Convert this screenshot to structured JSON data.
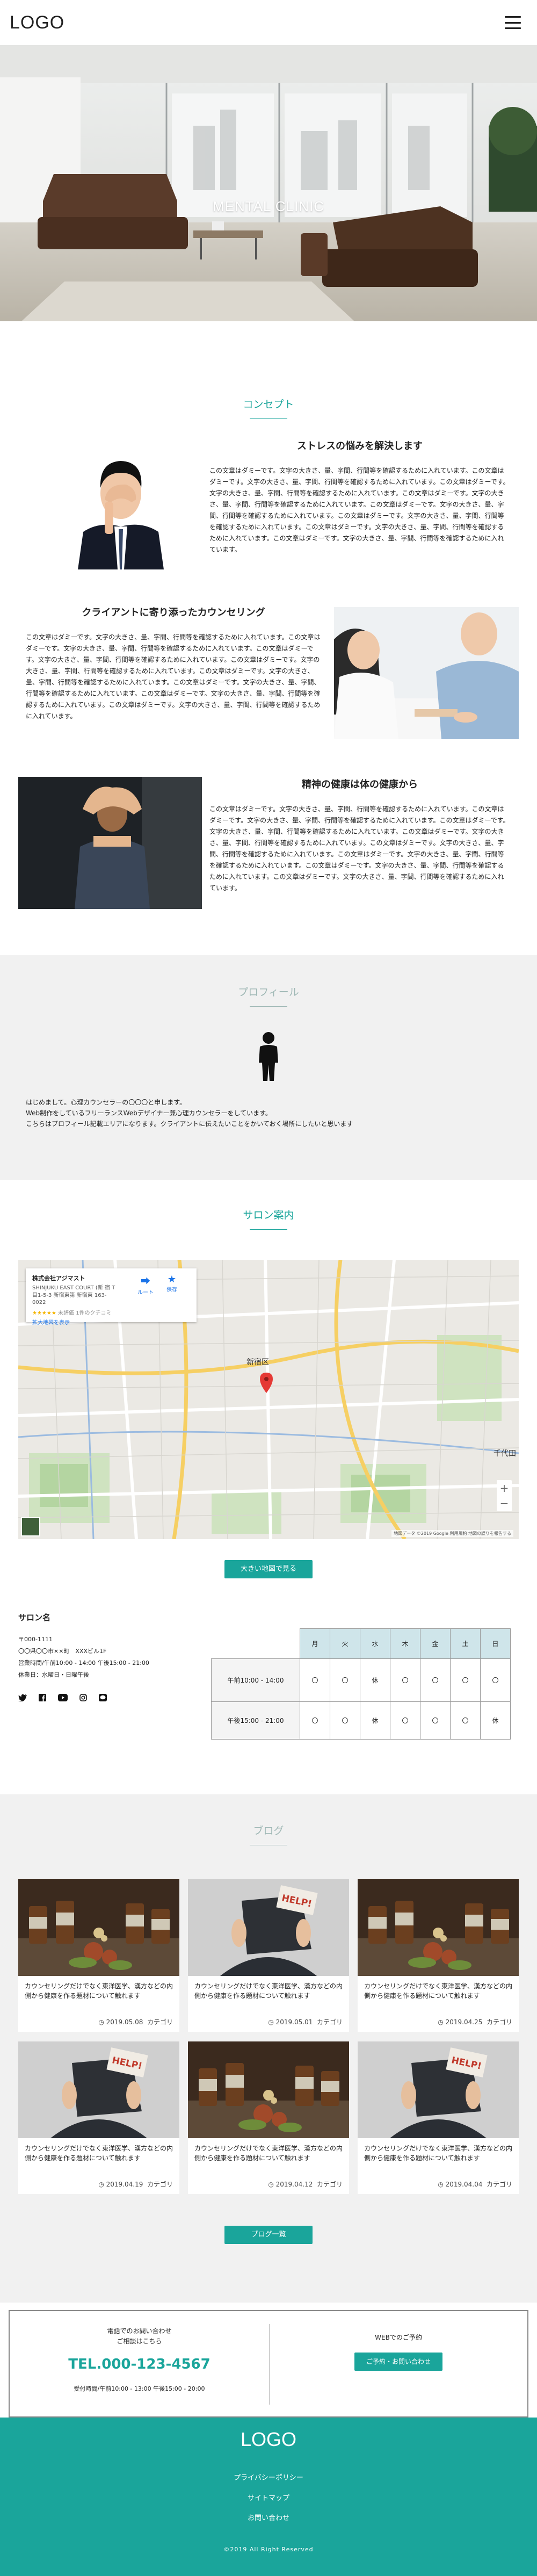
{
  "header": {
    "logo": "LOGO"
  },
  "hero": {
    "title": "MENTAL CLINIC"
  },
  "concept": {
    "heading": "コンセプト",
    "items": [
      {
        "title": "ストレスの悩みを解決します",
        "text": "この文章はダミーです。文字の大きさ、量、字間、行間等を確認するために入れています。この文章はダミーです。文字の大きさ、量、字間、行間等を確認するために入れています。この文章はダミーです。文字の大きさ、量、字間、行間等を確認するために入れています。この文章はダミーです。文字の大きさ、量、字間、行間等を確認するために入れています。この文章はダミーです。文字の大きさ、量、字間、行間等を確認するために入れています。この文章はダミーです。文字の大きさ、量、字間、行間等を確認するために入れています。この文章はダミーです。文字の大きさ、量、字間、行間等を確認するために入れています。この文章はダミーです。文字の大きさ、量、字間、行間等を確認するために入れています。"
      },
      {
        "title": "クライアントに寄り添ったカウンセリング",
        "text": "この文章はダミーです。文字の大きさ、量、字間、行間等を確認するために入れています。この文章はダミーです。文字の大きさ、量、字間、行間等を確認するために入れています。この文章はダミーです。文字の大きさ、量、字間、行間等を確認するために入れています。この文章はダミーです。文字の大きさ、量、字間、行間等を確認するために入れています。この文章はダミーです。文字の大きさ、量、字間、行間等を確認するために入れています。この文章はダミーです。文字の大きさ、量、字間、行間等を確認するために入れています。この文章はダミーです。文字の大きさ、量、字間、行間等を確認するために入れています。この文章はダミーです。文字の大きさ、量、字間、行間等を確認するために入れています。"
      },
      {
        "title": "精神の健康は体の健康から",
        "text": "この文章はダミーです。文字の大きさ、量、字間、行間等を確認するために入れています。この文章はダミーです。文字の大きさ、量、字間、行間等を確認するために入れています。この文章はダミーです。文字の大きさ、量、字間、行間等を確認するために入れています。この文章はダミーです。文字の大きさ、量、字間、行間等を確認するために入れています。この文章はダミーです。文字の大きさ、量、字間、行間等を確認するために入れています。この文章はダミーです。文字の大きさ、量、字間、行間等を確認するために入れています。この文章はダミーです。文字の大きさ、量、字間、行間等を確認するために入れています。この文章はダミーです。文字の大きさ、量、字間、行間等を確認するために入れています。"
      }
    ]
  },
  "profile": {
    "heading": "プロフィール",
    "lines": [
      "はじめまして。心理カウンセラーの〇〇〇と申します。",
      "Web制作をしているフリーランスWebデザイナー兼心理カウンセラーをしています。",
      "こちらはプロフィール記載エリアになります。クライアントに伝えたいことをかいておく場所にしたいと思います"
    ]
  },
  "access": {
    "heading": "サロン案内",
    "map": {
      "place_name": "株式会社アジマスト",
      "address_lines": [
        "SHINJUKU EAST COURT (新 宿 T",
        "目1-5-3 新宿東第 新宿東 163-",
        "0022"
      ],
      "rating_text": "未評価 1件のクチコミ",
      "link_text": "拡大地図を表示",
      "route_label": "ルート",
      "save_label": "保存",
      "districts": [
        "新宿区",
        "千代田"
      ],
      "footer_text": "地図データ ©2019 Google 利用規約 地図の誤りを報告する"
    },
    "map_button": "大きい地図で見る",
    "salon": {
      "name": "サロン名",
      "lines": [
        "〒000-1111",
        "〇〇県〇〇市××町　XXXビル1F",
        "営業時間/午前10:00 - 14:00 午後15:00 - 21:00",
        "休業日：水曜日・日曜午後"
      ],
      "social_icons": [
        "twitter-icon",
        "facebook-icon",
        "youtube-icon",
        "instagram-icon",
        "line-icon"
      ]
    },
    "hours_table": {
      "days": [
        "月",
        "火",
        "水",
        "木",
        "金",
        "土",
        "日"
      ],
      "rows": [
        {
          "label": "午前10:00 - 14:00",
          "cells": [
            "〇",
            "〇",
            "休",
            "〇",
            "〇",
            "〇",
            "〇"
          ]
        },
        {
          "label": "午後15:00 - 21:00",
          "cells": [
            "〇",
            "〇",
            "休",
            "〇",
            "〇",
            "〇",
            "休"
          ]
        }
      ]
    }
  },
  "blog": {
    "heading": "ブログ",
    "posts": [
      {
        "text": "カウンセリングだけでなく東洋医学、漢方などの内側から健康を作る題材について触れます",
        "date": "2019.05.08",
        "category": "カテゴリ",
        "thumb": "herbs"
      },
      {
        "text": "カウンセリングだけでなく東洋医学、漢方などの内側から健康を作る題材について触れます",
        "date": "2019.05.01",
        "category": "カテゴリ",
        "thumb": "help"
      },
      {
        "text": "カウンセリングだけでなく東洋医学、漢方などの内側から健康を作る題材について触れます",
        "date": "2019.04.25",
        "category": "カテゴリ",
        "thumb": "herbs"
      },
      {
        "text": "カウンセリングだけでなく東洋医学、漢方などの内側から健康を作る題材について触れます",
        "date": "2019.04.19",
        "category": "カテゴリ",
        "thumb": "help"
      },
      {
        "text": "カウンセリングだけでなく東洋医学、漢方などの内側から健康を作る題材について触れます",
        "date": "2019.04.12",
        "category": "カテゴリ",
        "thumb": "herbs"
      },
      {
        "text": "カウンセリングだけでなく東洋医学、漢方などの内側から健康を作る題材について触れます",
        "date": "2019.04.04",
        "category": "カテゴリ",
        "thumb": "help"
      }
    ],
    "help_sign": "HELP!",
    "list_button": "ブログ一覧"
  },
  "contact": {
    "phone_heading_1": "電話でのお問い合わせ",
    "phone_heading_2": "ご相談はこちら",
    "tel": "TEL.000-123-4567",
    "hours": "受付時間/午前10:00 - 13:00 午後15:00 - 20:00",
    "web_heading": "WEBでのご予約",
    "web_button": "ご予約・お問い合わせ"
  },
  "footer": {
    "logo": "LOGO",
    "links": [
      "プライバシーポリシー",
      "サイトマップ",
      "お問い合わせ"
    ],
    "copyright": "©2019 All Right Reserved"
  },
  "colors": {
    "accent": "#1aa59b",
    "section_gray": "#f1f1f1",
    "table_header": "#cfe5ea"
  }
}
